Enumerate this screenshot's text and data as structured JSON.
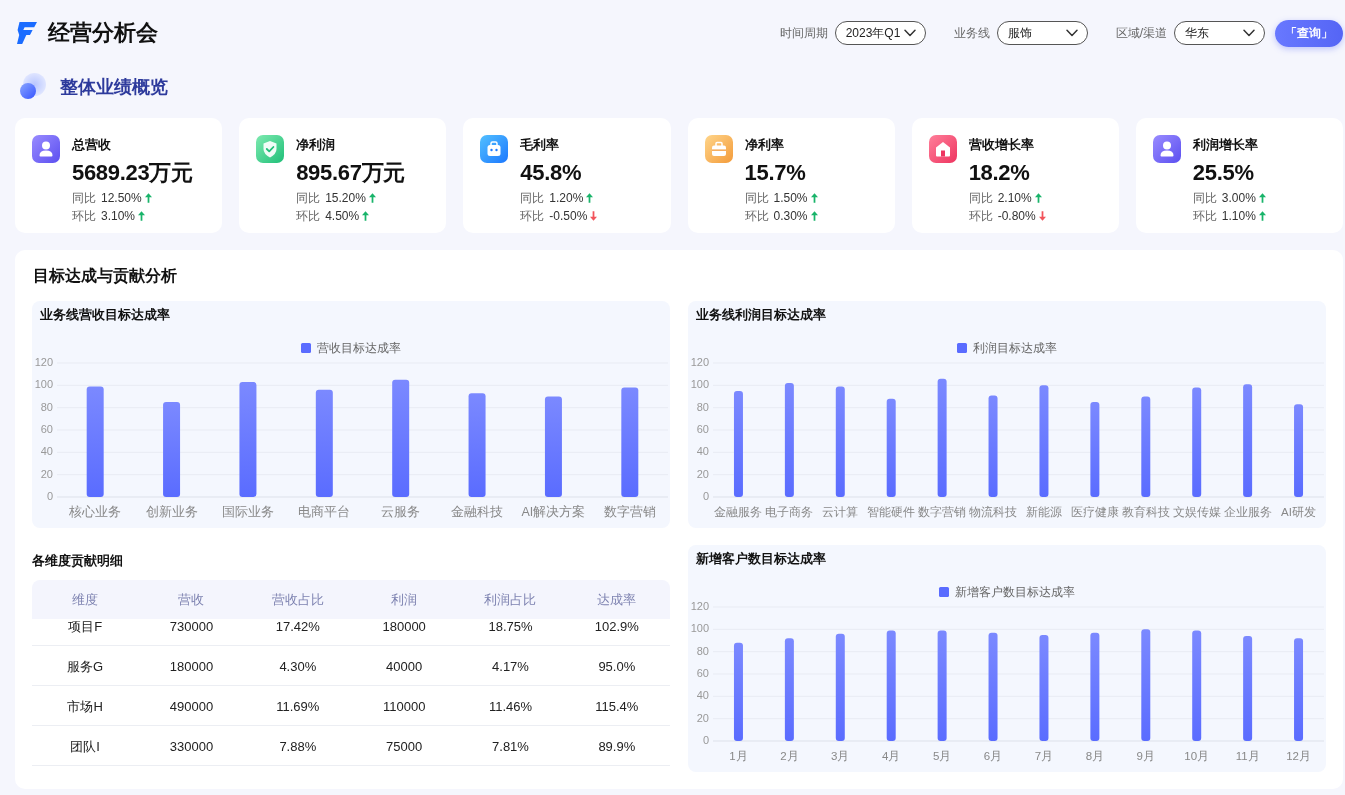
{
  "header": {
    "title": "经营分析会",
    "filters": [
      {
        "label": "时间周期",
        "value": "2023年Q1"
      },
      {
        "label": "业务线",
        "value": "服饰"
      },
      {
        "label": "区域/渠道",
        "value": "华东"
      }
    ],
    "query_button": "「查询」"
  },
  "overview": {
    "title": "整体业绩概览",
    "kpis": [
      {
        "label": "总营收",
        "value": "5689.23万元",
        "comparisons": [
          {
            "label": "同比",
            "value": "12.50%",
            "rising": true
          },
          {
            "label": "环比",
            "value": "3.10%",
            "rising": true
          }
        ]
      },
      {
        "label": "净利润",
        "value": "895.67万元",
        "comparisons": [
          {
            "label": "同比",
            "value": "15.20%",
            "rising": true
          },
          {
            "label": "环比",
            "value": "4.50%",
            "rising": true
          }
        ]
      },
      {
        "label": "毛利率",
        "value": "45.8%",
        "comparisons": [
          {
            "label": "同比",
            "value": "1.20%",
            "rising": true
          },
          {
            "label": "环比",
            "value": "-0.50%",
            "rising": false
          }
        ]
      },
      {
        "label": "净利率",
        "value": "15.7%",
        "comparisons": [
          {
            "label": "同比",
            "value": "1.50%",
            "rising": true
          },
          {
            "label": "环比",
            "value": "0.30%",
            "rising": true
          }
        ]
      },
      {
        "label": "营收增长率",
        "value": "18.2%",
        "comparisons": [
          {
            "label": "同比",
            "value": "2.10%",
            "rising": true
          },
          {
            "label": "环比",
            "value": "-0.80%",
            "rising": false
          }
        ]
      },
      {
        "label": "利润增长率",
        "value": "25.5%",
        "comparisons": [
          {
            "label": "同比",
            "value": "3.00%",
            "rising": true
          },
          {
            "label": "环比",
            "value": "1.10%",
            "rising": true
          }
        ]
      }
    ]
  },
  "analysis": {
    "title": "目标达成与贡献分析",
    "revenue_chart": {
      "chart_data": {
        "type": "bar",
        "title": "业务线营收目标达成率",
        "categories": [
          "核心业务",
          "创新业务",
          "国际业务",
          "电商平台",
          "云服务",
          "金融科技",
          "AI解决方案",
          "数字营销"
        ],
        "series": [
          {
            "name": "营收目标达成率",
            "color": "#5a6cff",
            "values": [
              99,
              85,
              103,
              96,
              105,
              93,
              90,
              98
            ]
          }
        ],
        "ylim": [
          0,
          120
        ],
        "yticks": [
          0,
          20,
          40,
          60,
          80,
          100,
          120
        ],
        "grid": true
      }
    },
    "profit_chart": {
      "chart_data": {
        "type": "bar",
        "title": "业务线利润目标达成率",
        "categories": [
          "金融服务",
          "电子商务",
          "云计算",
          "智能硬件",
          "数字营销",
          "物流科技",
          "新能源",
          "医疗健康",
          "教育科技",
          "文娱传媒",
          "企业服务",
          "AI研发"
        ],
        "series": [
          {
            "name": "利润目标达成率",
            "color": "#5a6cff",
            "values": [
              95,
              102,
              99,
              88,
              106,
              91,
              100,
              85,
              90,
              98,
              101,
              83
            ]
          }
        ],
        "ylim": [
          0,
          120
        ],
        "yticks": [
          0,
          20,
          40,
          60,
          80,
          100,
          120
        ],
        "grid": true
      }
    },
    "contribution_table": {
      "title": "各维度贡献明细",
      "columns": [
        "维度",
        "营收",
        "营收占比",
        "利润",
        "利润占比",
        "达成率"
      ],
      "rows": [
        [
          "项目F",
          "730000",
          "17.42%",
          "180000",
          "18.75%",
          "102.9%"
        ],
        [
          "服务G",
          "180000",
          "4.30%",
          "40000",
          "4.17%",
          "95.0%"
        ],
        [
          "市场H",
          "490000",
          "11.69%",
          "110000",
          "11.46%",
          "115.4%"
        ],
        [
          "团队I",
          "330000",
          "7.88%",
          "75000",
          "7.81%",
          "89.9%"
        ]
      ]
    },
    "customer_chart": {
      "chart_data": {
        "type": "bar",
        "title": "新增客户数目标达成率",
        "categories": [
          "1月",
          "2月",
          "3月",
          "4月",
          "5月",
          "6月",
          "7月",
          "8月",
          "9月",
          "10月",
          "11月",
          "12月"
        ],
        "series": [
          {
            "name": "新增客户数目标达成率",
            "color": "#5a6cff",
            "values": [
              88,
              92,
              96,
              99,
              99,
              97,
              95,
              97,
              100,
              99,
              94,
              92
            ]
          }
        ],
        "ylim": [
          0,
          120
        ],
        "yticks": [
          0,
          20,
          40,
          60,
          80,
          100,
          120
        ],
        "grid": true
      }
    }
  }
}
